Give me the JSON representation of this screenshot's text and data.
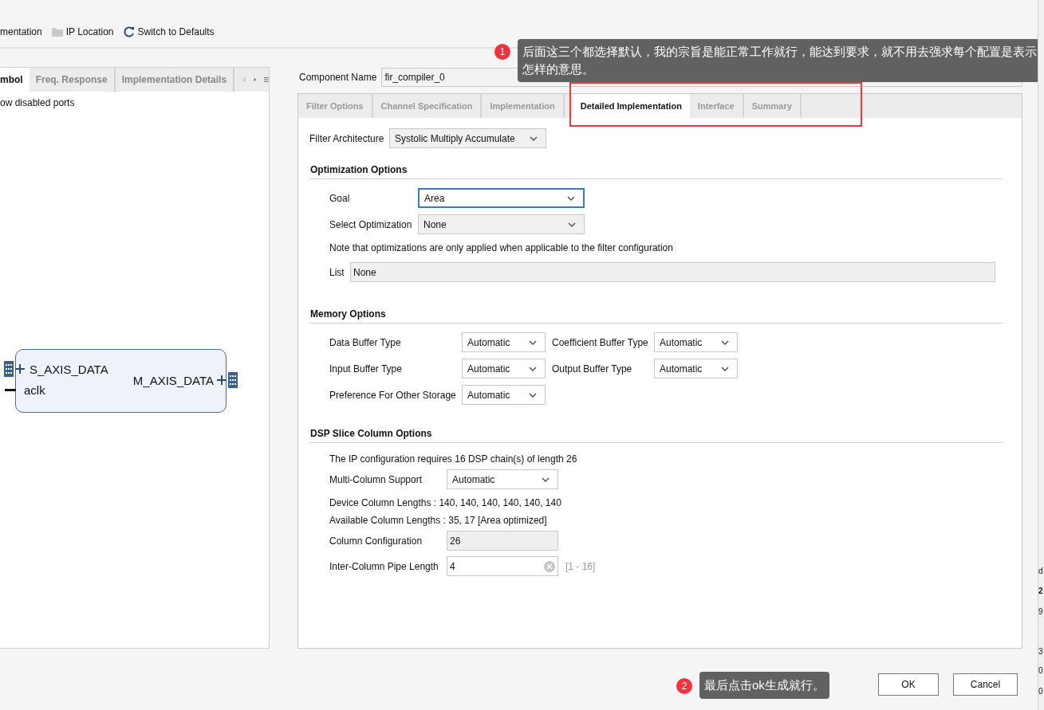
{
  "toolbar": [
    {
      "label": "mentation",
      "kind": "plain"
    },
    {
      "label": "IP Location",
      "kind": "folder"
    },
    {
      "label": "Switch to Defaults",
      "kind": "refresh"
    }
  ],
  "left_panel": {
    "tabs": [
      {
        "label": "mbol",
        "selected": true
      },
      {
        "label": "Freq. Response",
        "selected": false
      },
      {
        "label": "Implementation Details",
        "selected": false
      }
    ],
    "disabled_ports_label": "ow disabled ports",
    "symbol": {
      "inputs": [
        {
          "name": "S_AXIS_DATA",
          "kind": "bus"
        },
        {
          "name": "aclk",
          "kind": "wire"
        }
      ],
      "outputs": [
        {
          "name": "M_AXIS_DATA",
          "kind": "bus"
        }
      ]
    }
  },
  "component_name": {
    "label": "Component Name",
    "value": "fir_compiler_0"
  },
  "tabs": [
    {
      "label": "Filter Options",
      "selected": false
    },
    {
      "label": "Channel Specification",
      "selected": false
    },
    {
      "label": "Implementation",
      "selected": false
    },
    {
      "label": "Detailed Implementation",
      "selected": true
    },
    {
      "label": "Interface",
      "selected": false
    },
    {
      "label": "Summary",
      "selected": false
    }
  ],
  "filter_architecture": {
    "label": "Filter Architecture",
    "value": "Systolic Multiply Accumulate",
    "disabled": true
  },
  "optimization": {
    "title": "Optimization Options",
    "goal": {
      "label": "Goal",
      "value": "Area",
      "disabled": false,
      "focused": true
    },
    "select_optimization": {
      "label": "Select Optimization",
      "value": "None",
      "disabled": true,
      "focused": false
    },
    "note": "Note that optimizations are only applied when applicable to the filter configuration",
    "list": {
      "label": "List",
      "value": "None"
    }
  },
  "memory": {
    "title": "Memory Options",
    "fields": [
      {
        "label": "Data Buffer Type",
        "value": "Automatic"
      },
      {
        "label": "Coefficient Buffer Type",
        "value": "Automatic"
      },
      {
        "label": "Input Buffer Type",
        "value": "Automatic"
      },
      {
        "label": "Output Buffer Type",
        "value": "Automatic"
      },
      {
        "label": "Preference For Other Storage",
        "value": "Automatic"
      }
    ]
  },
  "dsp": {
    "title": "DSP Slice Column Options",
    "requirement": "The IP configuration requires 16 DSP chain(s) of length 26",
    "multi_column": {
      "label": "Multi-Column Support",
      "value": "Automatic"
    },
    "device_lengths": "Device Column Lengths : 140, 140, 140, 140, 140, 140",
    "available_lengths": "Available Column Lengths : 35, 17 [Area optimized]",
    "column_configuration": {
      "label": "Column Configuration",
      "value": "26"
    },
    "pipe_length": {
      "label": "Inter-Column Pipe Length",
      "value": "4",
      "range": "[1 - 16]"
    }
  },
  "buttons": [
    {
      "label": "OK"
    },
    {
      "label": "Cancel"
    }
  ],
  "annotations": [
    {
      "number": "1",
      "text": "后面这三个都选择默认，我的宗旨是能正常工作就行，能达到要求，就不用去强求每个配置是表示怎样的意思。"
    },
    {
      "number": "2",
      "text": "最后点击ok生成就行。"
    }
  ],
  "edge_fragments": [
    "d",
    "2",
    "9",
    "3",
    "0",
    "0"
  ]
}
